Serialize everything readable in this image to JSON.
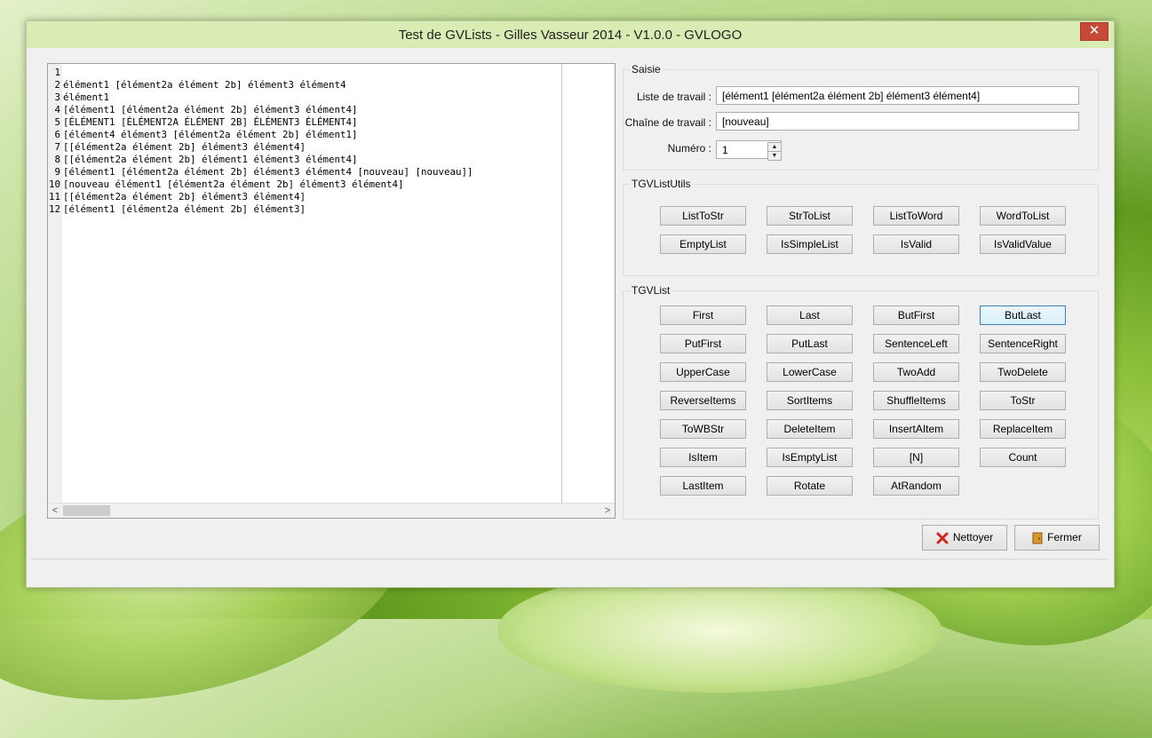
{
  "window": {
    "title": "Test de GVLists - Gilles Vasseur 2014 - V1.0.0 - GVLOGO",
    "close_glyph": "✕"
  },
  "editor": {
    "lines": [
      {
        "n": "1",
        "t": ""
      },
      {
        "n": "2",
        "t": "élément1 [élément2a élément 2b] élément3 élément4"
      },
      {
        "n": "3",
        "t": "élément1"
      },
      {
        "n": "4",
        "t": "[élément1 [élément2a élément 2b] élément3 élément4]"
      },
      {
        "n": "5",
        "t": "[ÉLÉMENT1 [ÉLÉMENT2A ÉLÉMENT 2B] ÉLÉMENT3 ÉLÉMENT4]"
      },
      {
        "n": "6",
        "t": "[élément4 élément3 [élément2a élément 2b] élément1]"
      },
      {
        "n": "7",
        "t": "[[élément2a élément 2b] élément3 élément4]"
      },
      {
        "n": "8",
        "t": "[[élément2a élément 2b] élément1 élément3 élément4]"
      },
      {
        "n": "9",
        "t": "[élément1 [élément2a élément 2b] élément3 élément4 [nouveau] [nouveau]]"
      },
      {
        "n": "10",
        "t": "[nouveau élément1 [élément2a élément 2b] élément3 élément4]"
      },
      {
        "n": "11",
        "t": "[[élément2a élément 2b] élément3 élément4]"
      },
      {
        "n": "12",
        "t": "[élément1 [élément2a élément 2b] élément3]"
      }
    ],
    "scroll_left": "<",
    "scroll_right": ">"
  },
  "saisie": {
    "title": "Saisie",
    "liste_label": "Liste de travail :",
    "liste_value": "[élément1 [élément2a élément 2b] élément3 élément4]",
    "chaine_label": "Chaîne de travail :",
    "chaine_value": "[nouveau]",
    "numero_label": "Numéro :",
    "numero_value": "1",
    "spin_up": "▲",
    "spin_down": "▼"
  },
  "utils": {
    "title": "TGVListUtils",
    "buttons": [
      "ListToStr",
      "StrToList",
      "ListToWord",
      "WordToList",
      "EmptyList",
      "IsSimpleList",
      "IsValid",
      "IsValidValue"
    ]
  },
  "list": {
    "title": "TGVList",
    "buttons": [
      "First",
      "Last",
      "ButFirst",
      "ButLast",
      "PutFirst",
      "PutLast",
      "SentenceLeft",
      "SentenceRight",
      "UpperCase",
      "LowerCase",
      "TwoAdd",
      "TwoDelete",
      "ReverseItems",
      "SortItems",
      "ShuffleItems",
      "ToStr",
      "ToWBStr",
      "DeleteItem",
      "InsertAItem",
      "ReplaceItem",
      "IsItem",
      "IsEmptyList",
      "[N]",
      "Count",
      "LastItem",
      "Rotate",
      "AtRandom"
    ]
  },
  "actions": {
    "nettoyer": "Nettoyer",
    "fermer": "Fermer"
  },
  "colors": {
    "close": "#c74a38",
    "title_bar": "#d8ecb4",
    "active_border": "#3c7fb1"
  }
}
